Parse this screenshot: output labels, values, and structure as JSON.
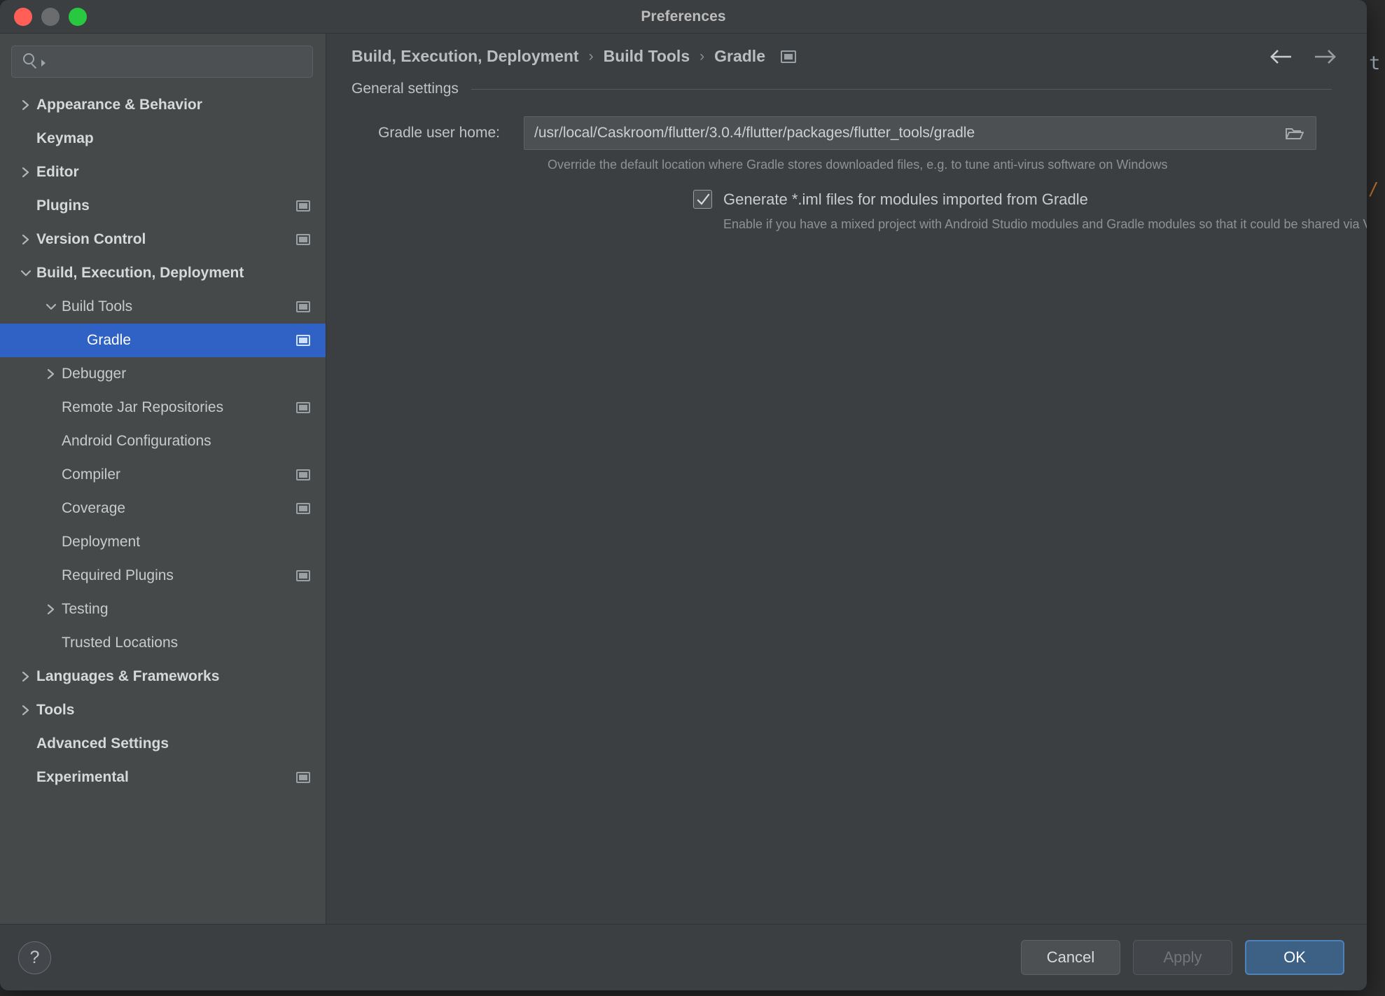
{
  "window": {
    "title": "Preferences",
    "traffic_lights": [
      "close",
      "minimize",
      "zoom"
    ]
  },
  "background": {
    "letter": "t",
    "slash": "/"
  },
  "search": {
    "value": "",
    "placeholder": "",
    "icon": "search-icon"
  },
  "sidebar": {
    "items": [
      {
        "label": "Appearance & Behavior",
        "indent": 0,
        "twisty": "right",
        "bold": true,
        "scope": false,
        "selected": false
      },
      {
        "label": "Keymap",
        "indent": 0,
        "twisty": "none",
        "bold": true,
        "scope": false,
        "selected": false
      },
      {
        "label": "Editor",
        "indent": 0,
        "twisty": "right",
        "bold": true,
        "scope": false,
        "selected": false
      },
      {
        "label": "Plugins",
        "indent": 0,
        "twisty": "none",
        "bold": true,
        "scope": true,
        "selected": false
      },
      {
        "label": "Version Control",
        "indent": 0,
        "twisty": "right",
        "bold": true,
        "scope": true,
        "selected": false
      },
      {
        "label": "Build, Execution, Deployment",
        "indent": 0,
        "twisty": "down",
        "bold": true,
        "scope": false,
        "selected": false
      },
      {
        "label": "Build Tools",
        "indent": 1,
        "twisty": "down",
        "bold": false,
        "scope": true,
        "selected": false
      },
      {
        "label": "Gradle",
        "indent": 2,
        "twisty": "none",
        "bold": false,
        "scope": true,
        "selected": true
      },
      {
        "label": "Debugger",
        "indent": 1,
        "twisty": "right",
        "bold": false,
        "scope": false,
        "selected": false
      },
      {
        "label": "Remote Jar Repositories",
        "indent": 1,
        "twisty": "none",
        "bold": false,
        "scope": true,
        "selected": false
      },
      {
        "label": "Android Configurations",
        "indent": 1,
        "twisty": "none",
        "bold": false,
        "scope": false,
        "selected": false
      },
      {
        "label": "Compiler",
        "indent": 1,
        "twisty": "none",
        "bold": false,
        "scope": true,
        "selected": false
      },
      {
        "label": "Coverage",
        "indent": 1,
        "twisty": "none",
        "bold": false,
        "scope": true,
        "selected": false
      },
      {
        "label": "Deployment",
        "indent": 1,
        "twisty": "none",
        "bold": false,
        "scope": false,
        "selected": false
      },
      {
        "label": "Required Plugins",
        "indent": 1,
        "twisty": "none",
        "bold": false,
        "scope": true,
        "selected": false
      },
      {
        "label": "Testing",
        "indent": 1,
        "twisty": "right",
        "bold": false,
        "scope": false,
        "selected": false
      },
      {
        "label": "Trusted Locations",
        "indent": 1,
        "twisty": "none",
        "bold": false,
        "scope": false,
        "selected": false
      },
      {
        "label": "Languages & Frameworks",
        "indent": 0,
        "twisty": "right",
        "bold": true,
        "scope": false,
        "selected": false
      },
      {
        "label": "Tools",
        "indent": 0,
        "twisty": "right",
        "bold": true,
        "scope": false,
        "selected": false
      },
      {
        "label": "Advanced Settings",
        "indent": 0,
        "twisty": "none",
        "bold": true,
        "scope": false,
        "selected": false
      },
      {
        "label": "Experimental",
        "indent": 0,
        "twisty": "none",
        "bold": true,
        "scope": true,
        "selected": false
      }
    ]
  },
  "breadcrumb": {
    "items": [
      "Build, Execution, Deployment",
      "Build Tools",
      "Gradle"
    ],
    "separator": "›",
    "scope_icon": "project-scope-icon",
    "back_icon": "arrow-left-icon",
    "forward_icon": "arrow-right-icon"
  },
  "main": {
    "section_title": "General settings",
    "gradle_user_home": {
      "label": "Gradle user home:",
      "value": "/usr/local/Caskroom/flutter/3.0.4/flutter/packages/flutter_tools/gradle",
      "placeholder": "",
      "browse_icon": "folder-icon",
      "hint": "Override the default location where Gradle stores downloaded files, e.g. to tune anti-virus software on Windows"
    },
    "generate_iml": {
      "label": "Generate *.iml files for modules imported from Gradle",
      "checked": true,
      "hint": "Enable if you have a mixed project with Android Studio modules and Gradle modules so that it could be shared via VCS"
    }
  },
  "footer": {
    "help_label": "?",
    "cancel_label": "Cancel",
    "apply_label": "Apply",
    "ok_label": "OK"
  },
  "colors": {
    "accent": "#2f62c4",
    "primary_button": "#3d6185",
    "dialog_bg": "#3c3f41",
    "sidebar_bg": "#45494a",
    "field_bg": "#4c5052"
  }
}
